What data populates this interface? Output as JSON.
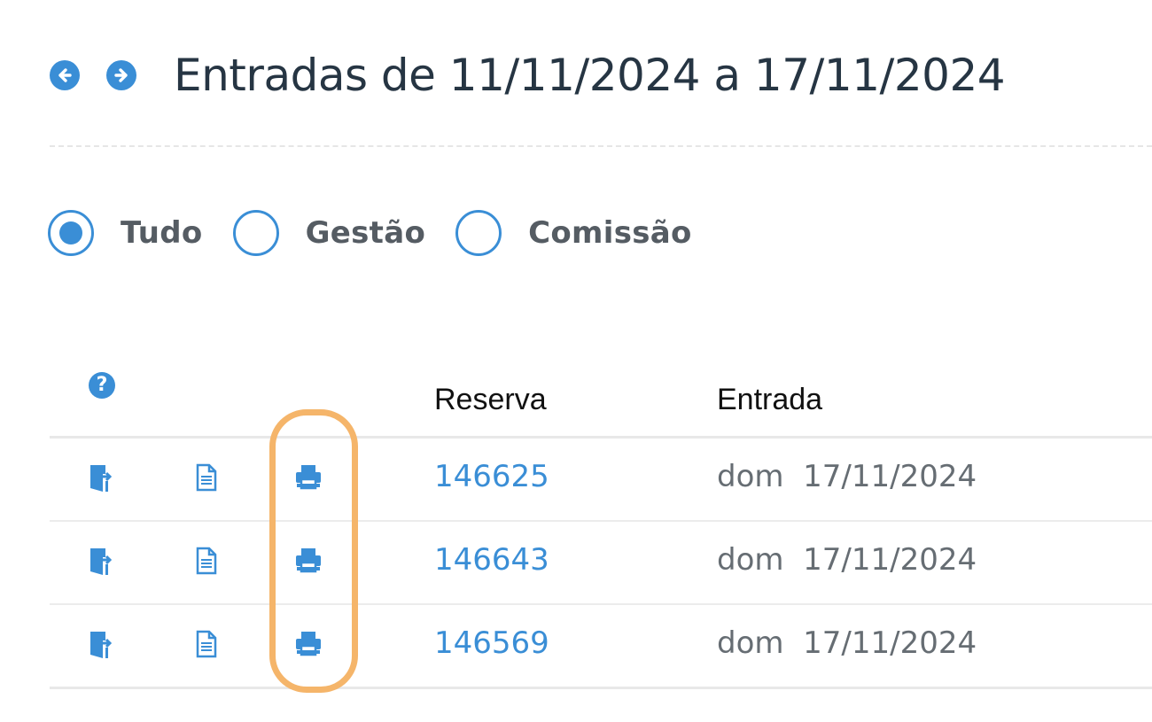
{
  "header": {
    "title": "Entradas de 11/11/2024 a 17/11/2024",
    "prev_icon": "arrow-left-circle-icon",
    "next_icon": "arrow-right-circle-icon"
  },
  "filters": {
    "options": [
      {
        "label": "Tudo",
        "selected": true
      },
      {
        "label": "Gestão",
        "selected": false
      },
      {
        "label": "Comissão",
        "selected": false
      }
    ]
  },
  "table": {
    "help_icon": "question-circle-icon",
    "help_symbol": "?",
    "columns": {
      "reserva": "Reserva",
      "entrada": "Entrada"
    },
    "rows": [
      {
        "reserva": "146625",
        "weekday": "dom",
        "date": "17/11/2024"
      },
      {
        "reserva": "146643",
        "weekday": "dom",
        "date": "17/11/2024"
      },
      {
        "reserva": "146569",
        "weekday": "dom",
        "date": "17/11/2024"
      }
    ],
    "row_icons": [
      "check-in-door-icon",
      "document-icon",
      "print-icon"
    ]
  },
  "colors": {
    "accent": "#3a8ed6",
    "title": "#263543",
    "highlight": "#f5b56a"
  }
}
